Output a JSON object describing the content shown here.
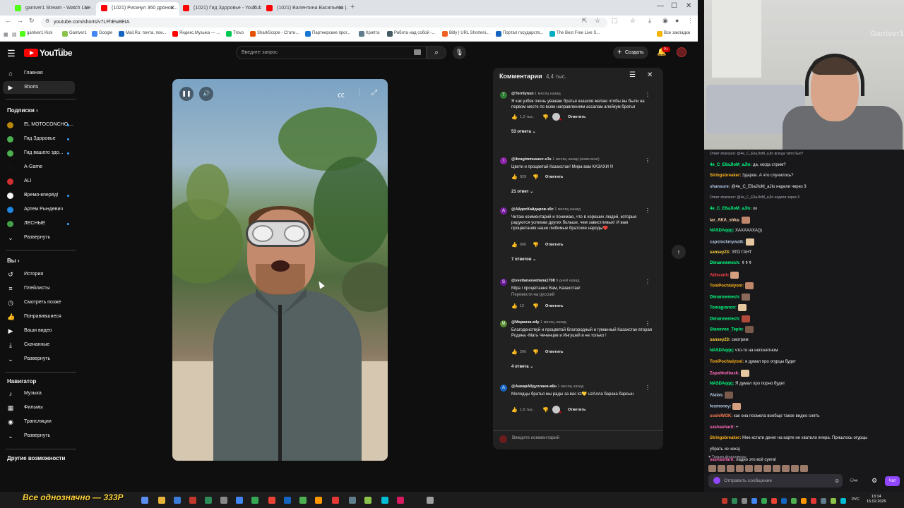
{
  "browser": {
    "tabs": [
      {
        "title": "gantver1 Stream - Watch Live ...",
        "color": "#53fc18"
      },
      {
        "title": "(1021) Рискнул 360 дронов...",
        "color": "#ff0000"
      },
      {
        "title": "(1021) Гид Здоровье - YouTub...",
        "color": "#ff0000"
      },
      {
        "title": "(1021) Валентина Васильева |...",
        "color": "#ff0000"
      }
    ],
    "url": "youtube.com/shorts/v7LFhEw8EIA",
    "bookmarks": [
      "gantver1 Kick",
      "Gantver1",
      "Google",
      "Mail.Ru: почта, пои...",
      "Яндекс.Музыка — ...",
      "Trovo",
      "SharkScope - Стати...",
      "Партнерские прог...",
      "Крипта",
      "Работа над собой -...",
      "Bitly | URL Shorteni...",
      "Портал государств...",
      "The Best Free Live S..."
    ],
    "all_bookmarks": "Все закладки"
  },
  "youtube": {
    "logo": "YouTube",
    "logo_region": "RU",
    "search_placeholder": "Введите запрос",
    "create_label": "Создать",
    "notif_count": "9+",
    "sidebar": {
      "main": [
        {
          "label": "Главная",
          "icon": "home-icon"
        },
        {
          "label": "Shorts",
          "icon": "shorts-icon"
        }
      ],
      "subs_header": "Подписки",
      "subs": [
        {
          "label": "EL MOTOCONCHO ...",
          "color": "#b8860b"
        },
        {
          "label": "Гид Здоровье",
          "color": "#4caf50"
        },
        {
          "label": "Гид вашего здо...",
          "color": "#4caf50"
        },
        {
          "label": "A-Game",
          "color": "#111111"
        },
        {
          "label": "ALI",
          "color": "#d32f2f"
        },
        {
          "label": "Время-вперёд!",
          "color": "#f5f5f5"
        },
        {
          "label": "Артем Рындевич",
          "color": "#1e88e5"
        },
        {
          "label": "ЛЕСНЫЕ",
          "color": "#43a047"
        },
        {
          "label": "Развернуть",
          "color": ""
        }
      ],
      "you_header": "Вы",
      "you": [
        "История",
        "Плейлисты",
        "Смотреть позже",
        "Понравившиеся",
        "Ваши видео",
        "Скачанные",
        "Развернуть"
      ],
      "nav_header": "Навигатор",
      "nav": [
        "Музыка",
        "Фильмы",
        "Трансляции",
        "Развернуть"
      ],
      "more_header": "Другие возможности"
    },
    "comments": {
      "title": "Комментарии",
      "count": "4,4 тыс.",
      "reply_label": "Ответить",
      "translate_label": "Перевести на русский",
      "add_placeholder": "Введите комментарий",
      "items": [
        {
          "author": "@Terrilynsn",
          "time": "1 месяц назад",
          "text": "Я как узбек очень уважаю братья казахов желаю чтобы вы были на первом месте по всем направлениям ассалам алейкум братья",
          "likes": "1,3 тыс.",
          "replies": "53 ответа",
          "avatar": "T",
          "avcolor": "#2e7d32"
        },
        {
          "author": "@ibragimmusaev-v3s",
          "time": "1 месяц назад (изменено)",
          "text": "Цвети и процветай Казахстан! Мира вам КАЗАХИ !!!",
          "likes": "929",
          "replies": "21 ответ",
          "avatar": "i",
          "avcolor": "#8e24aa"
        },
        {
          "author": "@АйдосКайдаров-з9с",
          "time": "1 месяц назад",
          "text": "Читаю комментарий и понимаю, что в хороших людей, которые радуются успехам других больше, чем завистливых! И вам процветания наши любимые братские народы❤️",
          "likes": "606",
          "replies": "7 ответов",
          "avatar": "А",
          "avcolor": "#7b1fa2"
        },
        {
          "author": "@svetlanasvetlana1708",
          "time": "9 дней назад",
          "text": "Міра і процвітання Вам, Казахстан!",
          "likes": "12",
          "replies": "",
          "avatar": "S",
          "avcolor": "#6a1b9a"
        },
        {
          "author": "@Маркиза-в4у",
          "time": "1 месяц назад",
          "text": "Благоденствуй и процветай благородный и гуманный Казахстан вторая Родина -Мать Чеченцев и Ингушей и не только !",
          "likes": "266",
          "replies": "4 ответа",
          "avatar": "М",
          "avcolor": "#558b2f"
        },
        {
          "author": "@АнварАбдуллаев-я6н",
          "time": "1 месяц назад",
          "text": "Молодцы братья мы рады за вас kz💛 uzАлла барака барсын",
          "likes": "1,6 тыс.",
          "replies": "",
          "avatar": "А",
          "avcolor": "#1565c0"
        }
      ]
    }
  },
  "webcam": {
    "watermark": "Gantver1"
  },
  "chat": {
    "lines": [
      {
        "sys": "Ответ shansure: @4e_C_E6aJIoM_aJIo всегда типо был?",
        "user": "",
        "text": "",
        "ucolor": ""
      },
      {
        "sys": "",
        "user": "4e_C_E6aJIoM_aJIo:",
        "text": "да, когда стрим?",
        "ucolor": "#00ff7f"
      },
      {
        "sys": "",
        "user": "Stringsbreaker:",
        "text": "Здаров. А что случилось?",
        "ucolor": "#ffb31a"
      },
      {
        "sys": "",
        "user": "shansure:",
        "text": "@4e_C_E6aJIoM_aJIo недели через 3",
        "ucolor": "#b0c4de"
      },
      {
        "sys": "Ответ shansure: @4e_C_E6aJIoM_aJIo недели через 3",
        "user": "",
        "text": "",
        "ucolor": ""
      },
      {
        "sys": "",
        "user": "4e_C_E6aJIoM_aJIo:",
        "text": "ок",
        "ucolor": "#00ff7f"
      },
      {
        "sys": "",
        "user": "tar_AKA_shka:",
        "text": "",
        "ucolor": "#ffd2a6",
        "emote": true
      },
      {
        "sys": "",
        "user": "NASDAqqq:",
        "text": "ХАХАХАХА)))",
        "ucolor": "#00ff7f"
      },
      {
        "sys": "",
        "user": "capslockmywalk:",
        "text": "",
        "ucolor": "#b0c4de",
        "emote": true
      },
      {
        "sys": "",
        "user": "sansey23:",
        "text": "ЭТО ГАНТ",
        "ucolor": "#ffd43b"
      },
      {
        "sys": "",
        "user": "Dimannemech:",
        "text": "⚱⚱⚱",
        "ucolor": "#00ff7f"
      },
      {
        "sys": "",
        "user": "Atlisrank:",
        "text": "",
        "ucolor": "#ff4040",
        "emote": true
      },
      {
        "sys": "",
        "user": "ToniPochtalyoni:",
        "text": "",
        "ucolor": "#ffb31a",
        "emote": true
      },
      {
        "sys": "",
        "user": "Dimannemech:",
        "text": "",
        "ucolor": "#00ff7f",
        "emote": true
      },
      {
        "sys": "",
        "user": "Toniagranon:",
        "text": "",
        "ucolor": "#00ff7f",
        "emote": true
      },
      {
        "sys": "",
        "user": "Dimannemech:",
        "text": "",
        "ucolor": "#00ff7f",
        "emote": true
      },
      {
        "sys": "",
        "user": "Stanovoe_Teplo:",
        "text": "",
        "ucolor": "#00ff7f",
        "emote": true
      },
      {
        "sys": "",
        "user": "sansey23:",
        "text": "смотрим",
        "ucolor": "#ffd43b"
      },
      {
        "sys": "",
        "user": "NASDAqqq:",
        "text": "что-то на непонятном",
        "ucolor": "#00ff7f"
      },
      {
        "sys": "",
        "user": "ToniPochtalyoni:",
        "text": "я думал про огурцы будет",
        "ucolor": "#ffb31a"
      },
      {
        "sys": "",
        "user": "Zapahkolbask:",
        "text": "",
        "ucolor": "#ff69b4",
        "emote": true
      },
      {
        "sys": "",
        "user": "NASDAqqq:",
        "text": "Я думал про порно будет",
        "ucolor": "#00ff7f"
      },
      {
        "sys": "",
        "user": "Alalas:",
        "text": "",
        "ucolor": "#b0c4de",
        "emote": true
      },
      {
        "sys": "",
        "user": "foxmoney:",
        "text": "",
        "ucolor": "#b0c4de",
        "emote": true
      },
      {
        "sys": "",
        "user": "sushiWOK:",
        "text": "как она посмела вообще такое видео снять",
        "ucolor": "#ff7f50"
      },
      {
        "sys": "",
        "user": "sashasharit:",
        "text": "+",
        "ucolor": "#ff69b4"
      },
      {
        "sys": "",
        "user": "Stringsbreaker:",
        "text": "Мне кстати денег на карте не хватило вчера. Пришлось огурцы",
        "ucolor": "#ffb31a"
      },
      {
        "sys": "",
        "user": "",
        "text": "убрать из чека)",
        "ucolor": ""
      },
      {
        "sys": "",
        "user": "sashasharit:",
        "text": "ладно это всё суета!",
        "ucolor": "#ff69b4"
      }
    ],
    "followers_only": "Только фолловеры",
    "input_placeholder": "Отправить сообщение",
    "send_label": "Чат"
  },
  "taskbar": {
    "banner": "Все однозначно — 333Р",
    "lang": "РУС",
    "time": "13:14",
    "date": "15.02.2025"
  }
}
